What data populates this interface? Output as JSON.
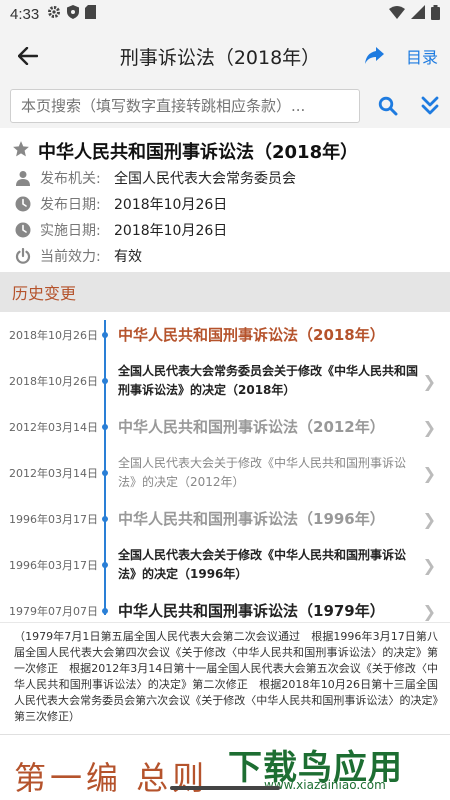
{
  "status_bar": {
    "time": "4:33"
  },
  "app_bar": {
    "title": "刑事诉讼法（2018年）",
    "toc_label": "目录"
  },
  "search": {
    "placeholder": "本页搜索（填写数字直接转跳相应条款）..."
  },
  "law": {
    "title": "中华人民共和国刑事诉讼法（2018年）",
    "info": [
      {
        "icon": "person-icon",
        "label": "发布机关:",
        "value": "全国人民代表大会常务委员会"
      },
      {
        "icon": "clock-icon",
        "label": "发布日期:",
        "value": "2018年10月26日"
      },
      {
        "icon": "clock-icon",
        "label": "实施日期:",
        "value": "2018年10月26日"
      },
      {
        "icon": "power-icon",
        "label": "当前效力:",
        "value": "有效"
      }
    ]
  },
  "history": {
    "header": "历史变更",
    "items": [
      {
        "date": "2018年10月26日",
        "text": "中华人民共和国刑事诉讼法（2018年）",
        "style": "current"
      },
      {
        "date": "2018年10月26日",
        "text": "全国人民代表大会常务委员会关于修改《中华人民共和国刑事诉讼法》的决定（2018年）",
        "style": "dark-small"
      },
      {
        "date": "2012年03月14日",
        "text": "中华人民共和国刑事诉讼法（2012年）",
        "style": "gray-big"
      },
      {
        "date": "2012年03月14日",
        "text": "全国人民代表大会关于修改《中华人民共和国刑事诉讼法》的决定（2012年）",
        "style": "gray-small"
      },
      {
        "date": "1996年03月17日",
        "text": "中华人民共和国刑事诉讼法（1996年）",
        "style": "gray-big"
      },
      {
        "date": "1996年03月17日",
        "text": "全国人民代表大会关于修改《中华人民共和国刑事诉讼法》的决定（1996年）",
        "style": "dark-small"
      },
      {
        "date": "1979年07月07日",
        "text": "中华人民共和国刑事诉讼法（1979年）",
        "style": "dark-big"
      }
    ]
  },
  "preface": "（1979年7月1日第五届全国人民代表大会第二次会议通过　根据1996年3月17日第八届全国人民代表大会第四次会议《关于修改〈中华人民共和国刑事诉讼法〉的决定》第一次修正　根据2012年3月14日第十一届全国人民代表大会第五次会议《关于修改〈中华人民共和国刑事诉讼法〉的决定》第二次修正　根据2018年10月26日第十三届全国人民代表大会常务委员会第六次会议《关于修改〈中华人民共和国刑事诉讼法〉的决定》第三次修正）",
  "chapter": {
    "title": "第一编 总则"
  },
  "watermark": {
    "main": "下载鸟应用",
    "url": "www.xiazainiao.com"
  },
  "colors": {
    "accent_blue": "#1e7be0",
    "accent_red": "#b5532c",
    "watermark_green": "#1d6e32"
  }
}
